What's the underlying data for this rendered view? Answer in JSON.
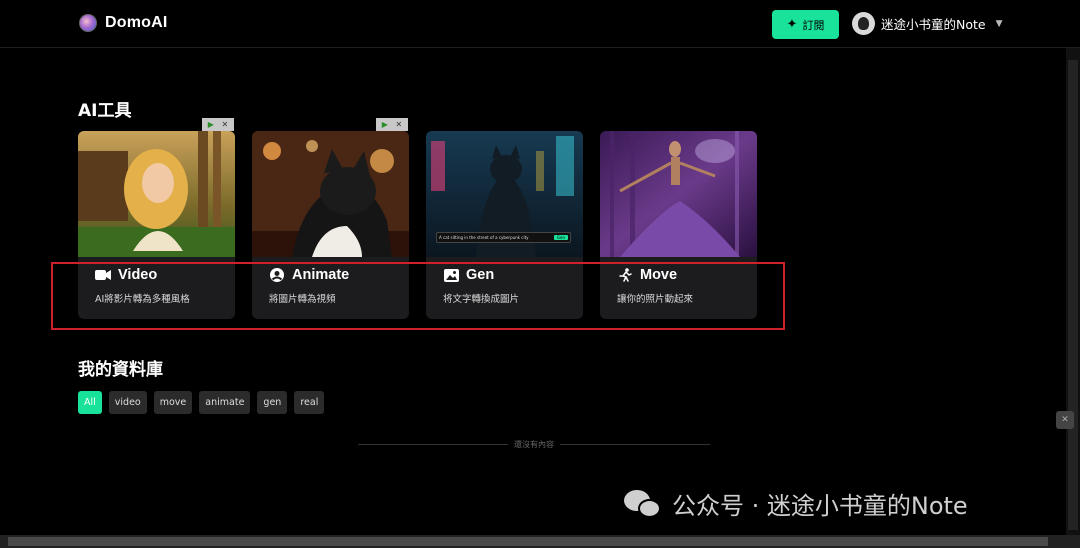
{
  "header": {
    "app_name": "DomoAI",
    "subscribe_label": "訂閱",
    "user_name": "迷途小书童的Note"
  },
  "tools": {
    "title": "AI工具",
    "cards": [
      {
        "title": "Video",
        "description": "AI將影片轉為多種風格",
        "icon": "video-camera-icon",
        "has_ad": true
      },
      {
        "title": "Animate",
        "description": "將圖片轉為視頻",
        "icon": "user-circle-icon",
        "has_ad": true
      },
      {
        "title": "Gen",
        "description": "将文字轉換成圖片",
        "icon": "image-icon",
        "has_ad": false,
        "image_caption": "A cat sitting in the street of a cyberpunk city",
        "image_button": "Gen"
      },
      {
        "title": "Move",
        "description": "讓你的照片動起來",
        "icon": "running-person-icon",
        "has_ad": false
      }
    ]
  },
  "library": {
    "title": "我的資料庫",
    "filters": [
      "All",
      "video",
      "move",
      "animate",
      "gen",
      "real"
    ],
    "active_filter": "All",
    "empty_text": "還沒有內容"
  },
  "watermark": {
    "text": "公众号 · 迷途小书童的Note"
  },
  "colors": {
    "accent": "#19e29a",
    "highlight": "#d0202a",
    "background": "#000000",
    "card": "#1c1c1f"
  }
}
